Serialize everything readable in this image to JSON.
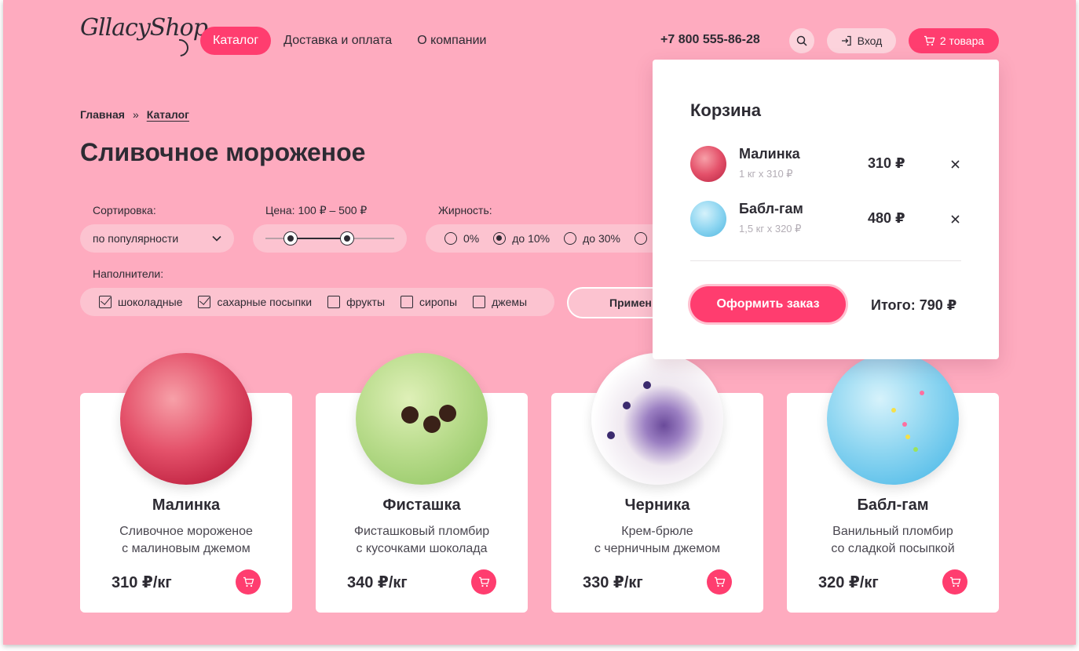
{
  "header": {
    "logo": "GllacyShop",
    "nav": [
      "Каталог",
      "Доставка и оплата",
      "О компании"
    ],
    "phone": "+7 800 555-86-28",
    "login_label": "Вход",
    "cart_label": "2 товара"
  },
  "breadcrumbs": {
    "home": "Главная",
    "separator": "»",
    "current": "Каталог"
  },
  "page_title": "Сливочное мороженое",
  "filters": {
    "sort_label": "Сортировка:",
    "sort_value": "по популярности",
    "price_label": "Цена: 100 ₽ – 500 ₽",
    "price_range": {
      "min": 100,
      "max": 500
    },
    "fat_label": "Жирность:",
    "fat_options": [
      {
        "label": "0%",
        "selected": false
      },
      {
        "label": "до 10%",
        "selected": true
      },
      {
        "label": "до 30%",
        "selected": false
      }
    ],
    "fillers_label": "Наполнители:",
    "fillers": [
      {
        "label": "шоколадные",
        "checked": true
      },
      {
        "label": "сахарные посыпки",
        "checked": true
      },
      {
        "label": "фрукты",
        "checked": false
      },
      {
        "label": "сиропы",
        "checked": false
      },
      {
        "label": "джемы",
        "checked": false
      }
    ],
    "apply_label": "Примен"
  },
  "products": [
    {
      "name": "Малинка",
      "desc1": "Сливочное мороженое",
      "desc2": "с малиновым джемом",
      "price": "310 ₽/кг"
    },
    {
      "name": "Фисташка",
      "desc1": "Фисташковый пломбир",
      "desc2": "с кусочками шоколада",
      "price": "340 ₽/кг"
    },
    {
      "name": "Черника",
      "desc1": "Крем-брюле",
      "desc2": "с черничным джемом",
      "price": "330 ₽/кг"
    },
    {
      "name": "Бабл-гам",
      "desc1": "Ванильный пломбир",
      "desc2": "со сладкой посыпкой",
      "price": "320 ₽/кг"
    }
  ],
  "cart": {
    "title": "Корзина",
    "items": [
      {
        "name": "Малинка",
        "qty": "1 кг х 310 ₽",
        "price": "310 ₽"
      },
      {
        "name": "Бабл-гам",
        "qty": "1,5 кг х 320 ₽",
        "price": "480 ₽"
      }
    ],
    "checkout_label": "Оформить заказ",
    "total": "Итого: 790 ₽"
  },
  "colors": {
    "background": "#feabbf",
    "accent": "#ff3d6f",
    "text": "#2d2b33"
  }
}
